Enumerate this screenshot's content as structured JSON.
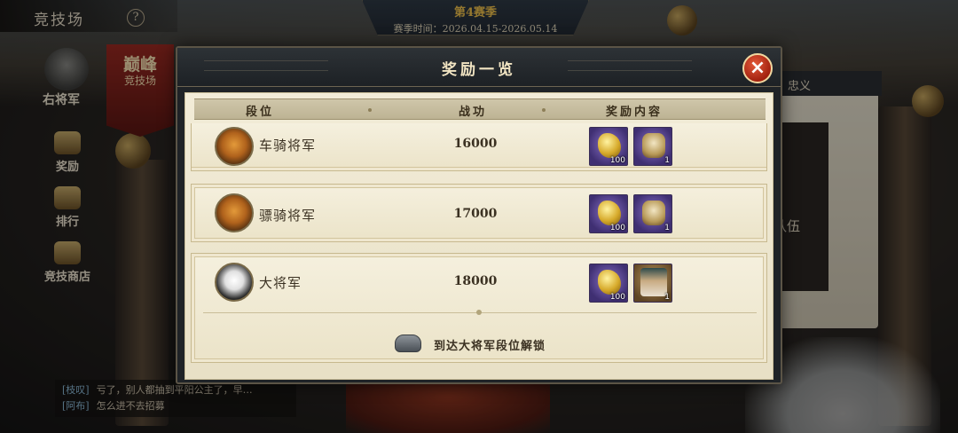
{
  "topbar": {
    "back_title": "竞技场",
    "help": "?"
  },
  "season": {
    "title": "第4赛季",
    "time": "赛季时间：2026.04.15-2026.05.14"
  },
  "sidebar": {
    "rank_name": "右将军",
    "items": [
      {
        "label": "奖励",
        "icon": "reward-chest-icon"
      },
      {
        "label": "排行",
        "icon": "leaderboard-icon"
      },
      {
        "label": "竞技商店",
        "icon": "shop-icon"
      }
    ],
    "peak_banner": {
      "line1": "巅峰",
      "line2": "竞技场"
    }
  },
  "right_panel": {
    "tab": "忠义",
    "inner_text": "队伍"
  },
  "chat": [
    {
      "name": "[枝叹]",
      "msg": "亏了，别人都抽到平阳公主了，早…"
    },
    {
      "name": "[阿布]",
      "msg": "怎么进不去招募"
    }
  ],
  "modal": {
    "title": "奖励一览",
    "close": "×",
    "headers": {
      "rank": "段位",
      "power": "战功",
      "rewards": "奖励内容"
    },
    "tiers": [
      {
        "name": "车骑将军",
        "power": "16000",
        "icon": "tiger",
        "rewards": [
          {
            "kind": "gold-ingot",
            "count": "100"
          },
          {
            "kind": "token",
            "count": "1"
          }
        ]
      },
      {
        "name": "骠骑将军",
        "power": "17000",
        "icon": "tiger",
        "rewards": [
          {
            "kind": "gold-ingot",
            "count": "100"
          },
          {
            "kind": "token",
            "count": "1"
          }
        ]
      },
      {
        "name": "大将军",
        "power": "18000",
        "icon": "panda",
        "rewards": [
          {
            "kind": "gold-ingot",
            "count": "100"
          },
          {
            "kind": "general-portrait",
            "count": "1"
          }
        ]
      }
    ],
    "unlock_text": "到达大将军段位解锁"
  },
  "colors": {
    "accent_gold": "#f0c24c",
    "close_red": "#c0341a",
    "reward_purple": "#5a449a"
  }
}
